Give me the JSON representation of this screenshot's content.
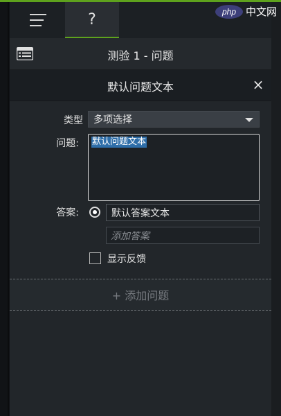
{
  "tabs": {
    "menu_icon": "hamburger-icon",
    "help_label": "?"
  },
  "watermark": {
    "badge": "php",
    "text": "中文网"
  },
  "header": {
    "title": "测验 1 - 问题",
    "list_icon": "list-icon"
  },
  "question_panel": {
    "title": "默认问题文本",
    "close_label": "×",
    "type_label": "类型",
    "type_value": "多项选择",
    "question_label": "问题:",
    "question_text": "默认问题文本",
    "answer_label": "答案:",
    "answer_value": "默认答案文本",
    "add_answer_placeholder": "添加答案",
    "show_feedback_label": "显示反馈",
    "add_question_label": "+ 添加问题"
  },
  "colors": {
    "accent": "#5ea21d",
    "panel_bg": "#22262a",
    "selection": "#2e6ea9"
  }
}
